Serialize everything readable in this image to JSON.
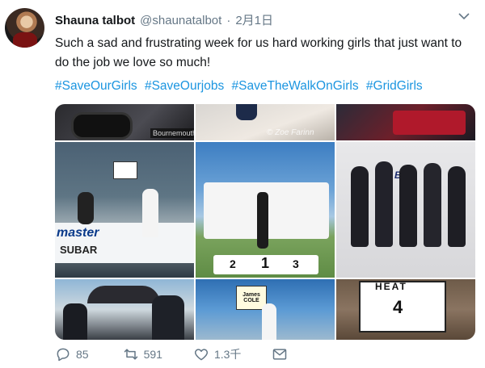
{
  "tweet": {
    "author_name": "Shauna talbot",
    "handle": "@shaunatalbot",
    "separator": "·",
    "date": "2月1日",
    "text": "Such a sad and frustrating week for us hard working girls that just want to do the job we love so much!",
    "hashtags": [
      "#SaveOurGirls",
      "#SaveOurjobs",
      "#SaveTheWalkOnGirls",
      "#GridGirls"
    ]
  },
  "media": {
    "watermark": "© Zoe Farinn",
    "tile_top_left_text": "Bournemouth",
    "sign_top": "HEAT",
    "sign_number": "4",
    "podium_numbers": [
      "2",
      "1",
      "3"
    ],
    "banner_bmr": "BMR",
    "car_text_1": "master",
    "car_text_2": "SUBAR",
    "board_name": "James COLE"
  },
  "actions": {
    "reply_count": "85",
    "retweet_count": "591",
    "like_count": "1.3千",
    "share_label": ""
  },
  "colors": {
    "link": "#1b95e0",
    "muted": "#657786",
    "text": "#14171a"
  }
}
